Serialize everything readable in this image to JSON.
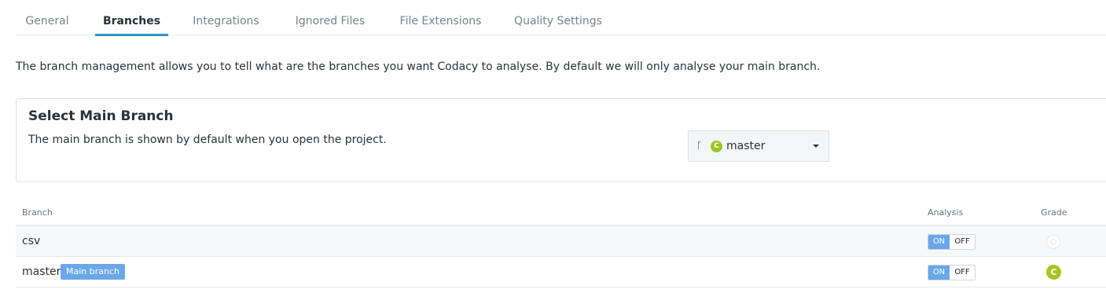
{
  "tabs": [
    {
      "label": "General"
    },
    {
      "label": "Branches"
    },
    {
      "label": "Integrations"
    },
    {
      "label": "Ignored Files"
    },
    {
      "label": "File Extensions"
    },
    {
      "label": "Quality Settings"
    }
  ],
  "active_tab": "Branches",
  "intro": "The branch management allows you to tell what are the branches you want Codacy to analyse. By default we will only analyse your main branch.",
  "main_branch_panel": {
    "title": "Select Main Branch",
    "description": "The main branch is shown by default when you open the project.",
    "selected_branch": "master",
    "selected_grade": "C",
    "branch_icon": "code-branch-icon"
  },
  "table": {
    "headers": {
      "branch": "Branch",
      "analysis": "Analysis",
      "grade": "Grade"
    },
    "rows": [
      {
        "name": "csv",
        "badge": "",
        "on_label": "ON",
        "off_label": "OFF",
        "analysis": "on",
        "grade": ""
      },
      {
        "name": "master",
        "badge": "Main branch",
        "on_label": "ON",
        "off_label": "OFF",
        "analysis": "on",
        "grade": "C"
      }
    ]
  },
  "colors": {
    "accent": "#2d94c6",
    "toggle_on": "#69a7e8",
    "grade_c": "#a6c51c"
  }
}
